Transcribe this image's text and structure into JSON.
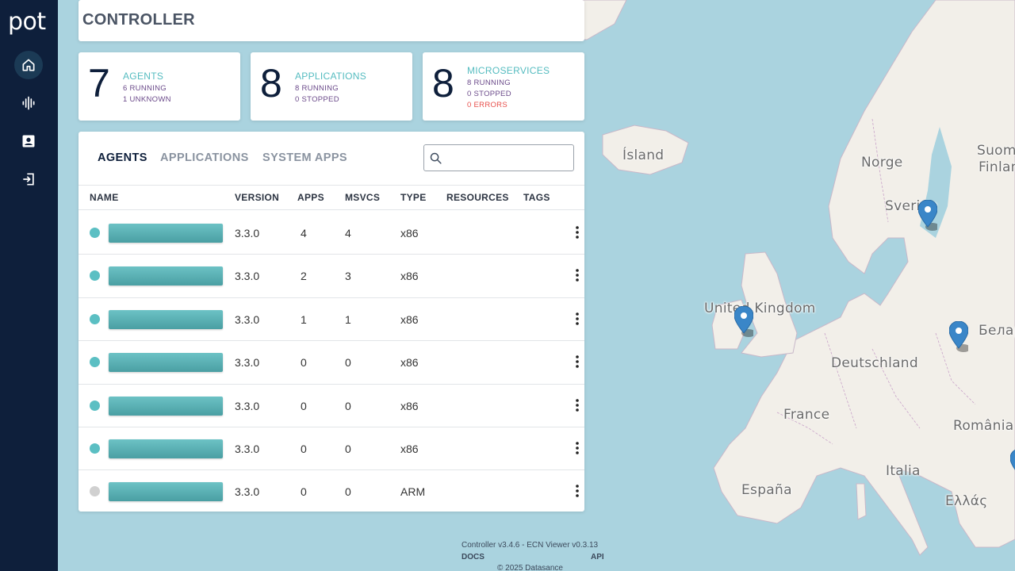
{
  "app": {
    "logo": "pot",
    "title": "CONTROLLER"
  },
  "sidebar": {
    "items": [
      {
        "icon": "home-icon",
        "active": true
      },
      {
        "icon": "waveform-icon",
        "active": false
      },
      {
        "icon": "account-box-icon",
        "active": false
      },
      {
        "icon": "logout-icon",
        "active": false
      }
    ]
  },
  "stats": {
    "agents": {
      "count": "7",
      "label": "AGENTS",
      "lines": [
        "6 RUNNING",
        "1 UNKNOWN"
      ]
    },
    "applications": {
      "count": "8",
      "label": "APPLICATIONS",
      "lines": [
        "8 RUNNING",
        "0 STOPPED"
      ]
    },
    "microservices": {
      "count": "8",
      "label": "MICROSERVICES",
      "lines": [
        "8 RUNNING",
        "0 STOPPED",
        "0 ERRORS"
      ]
    }
  },
  "tabs": [
    {
      "label": "AGENTS",
      "active": true
    },
    {
      "label": "APPLICATIONS",
      "active": false
    },
    {
      "label": "SYSTEM APPS",
      "active": false
    }
  ],
  "search": {
    "placeholder": "",
    "value": ""
  },
  "table": {
    "headers": [
      "NAME",
      "VERSION",
      "APPS",
      "MSVCS",
      "TYPE",
      "RESOURCES",
      "TAGS"
    ],
    "rows": [
      {
        "status": "running",
        "version": "3.3.0",
        "apps": "4",
        "msvcs": "4",
        "type": "x86"
      },
      {
        "status": "running",
        "version": "3.3.0",
        "apps": "2",
        "msvcs": "3",
        "type": "x86"
      },
      {
        "status": "running",
        "version": "3.3.0",
        "apps": "1",
        "msvcs": "1",
        "type": "x86"
      },
      {
        "status": "running",
        "version": "3.3.0",
        "apps": "0",
        "msvcs": "0",
        "type": "x86"
      },
      {
        "status": "running",
        "version": "3.3.0",
        "apps": "0",
        "msvcs": "0",
        "type": "x86"
      },
      {
        "status": "running",
        "version": "3.3.0",
        "apps": "0",
        "msvcs": "0",
        "type": "x86"
      },
      {
        "status": "unknown",
        "version": "3.3.0",
        "apps": "0",
        "msvcs": "0",
        "type": "ARM"
      }
    ]
  },
  "colors": {
    "sidebar": "#0e1f3b",
    "accent": "#55bcc0",
    "running": "#5bbfc3",
    "unknown": "#d0d0d0",
    "error": "#e8504c",
    "map_pin": "#3a86c8"
  },
  "map": {
    "labels": [
      "Ísland",
      "Norge",
      "Sverige",
      "Suomi",
      "Finland",
      "United Kingdom",
      "Беларусь",
      "Deutschland",
      "France",
      "România",
      "Italia",
      "España",
      "Ελλάς"
    ]
  },
  "footer": {
    "version": "Controller v3.4.6 - ECN Viewer v0.3.13",
    "docs": "DOCS",
    "api": "API",
    "copyright": "© 2025 Datasance"
  }
}
